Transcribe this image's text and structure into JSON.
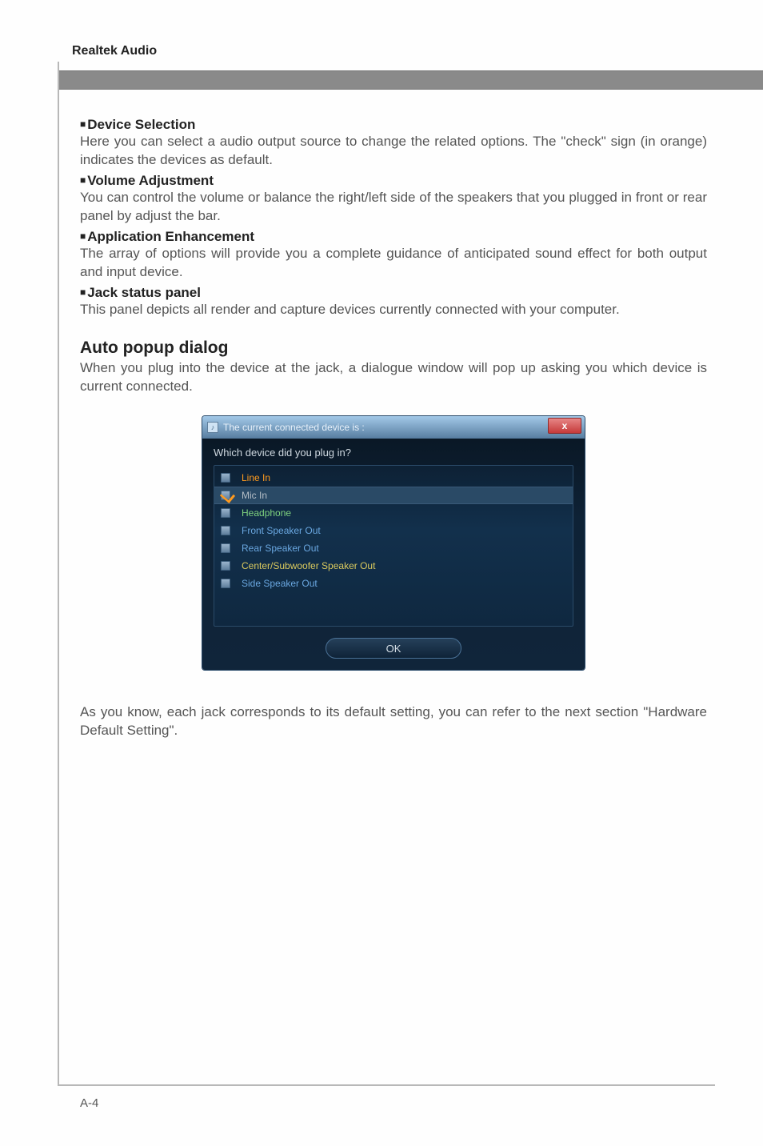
{
  "header": {
    "title": "Realtek Audio"
  },
  "sections": {
    "device_selection": {
      "title": "Device Selection",
      "body": "Here you can select a audio output source to change the related options. The \"check\" sign (in orange) indicates the devices as default."
    },
    "volume": {
      "title": "Volume Adjustment",
      "body": "You can control the volume or balance the right/left side of the speakers that you plugged in front or rear panel by adjust the bar."
    },
    "enhancement": {
      "title": "Application Enhancement",
      "body": "The array of options will provide you a complete guidance of anticipated sound effect for both output and input device."
    },
    "jack": {
      "title": "Jack status panel",
      "body": "This panel depicts all render and capture devices currently connected with your computer."
    }
  },
  "auto_popup": {
    "heading": "Auto popup dialog",
    "intro": "When you plug into the device at the jack, a dialogue window will pop up asking you which device is current connected."
  },
  "dialog": {
    "title": "The current connected device is :",
    "prompt": "Which device did you plug in?",
    "close": "x",
    "ok": "OK",
    "items": [
      {
        "label": "Line In",
        "selected": false,
        "color": "c-orange"
      },
      {
        "label": "Mic In",
        "selected": true,
        "color": "c-gray"
      },
      {
        "label": "Headphone",
        "selected": false,
        "color": "c-green"
      },
      {
        "label": "Front Speaker Out",
        "selected": false,
        "color": "c-blue"
      },
      {
        "label": "Rear Speaker Out",
        "selected": false,
        "color": "c-blue"
      },
      {
        "label": "Center/Subwoofer Speaker Out",
        "selected": false,
        "color": "c-yellow"
      },
      {
        "label": "Side Speaker Out",
        "selected": false,
        "color": "c-blue"
      }
    ]
  },
  "closing": "As you know, each jack corresponds to its default setting, you can refer to the next section \"Hardware Default Setting\".",
  "footer": "A-4"
}
